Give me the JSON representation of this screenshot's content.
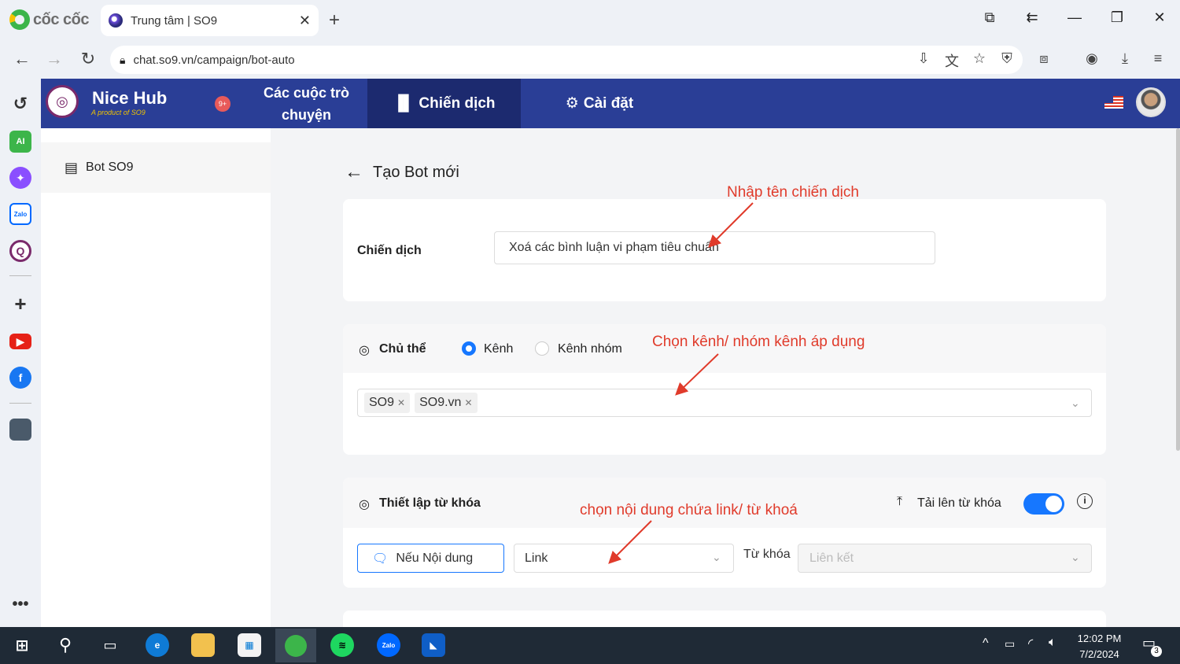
{
  "browser": {
    "brand": "cốc cốc",
    "tab_title": "Trung tâm | SO9",
    "url": "chat.so9.vn/campaign/bot-auto"
  },
  "app": {
    "name": "Nice Hub",
    "tagline": "A product of SO9",
    "notif_count": "9+",
    "nav": {
      "conversations": "Các cuộc trò chuyện",
      "campaign": "Chiến dịch",
      "settings": "Cài đặt"
    }
  },
  "sidebar": {
    "items": [
      {
        "label": "Bot SO9"
      }
    ]
  },
  "page": {
    "title": "Tạo Bot mới",
    "campaign": {
      "label": "Chiến dịch",
      "value": "Xoá các bình luận vi phạm tiêu chuẩn"
    },
    "subject": {
      "label": "Chủ thể",
      "options": [
        "Kênh",
        "Kênh nhóm"
      ],
      "selected": "Kênh",
      "tags": [
        "SO9",
        "SO9.vn"
      ]
    },
    "keyword": {
      "label": "Thiết lập từ khóa",
      "upload_label": "Tải lên từ khóa",
      "toggle_on": true,
      "condition_button": "Nếu Nội dung",
      "condition_value": "Link",
      "keyword_label": "Từ khóa",
      "keyword_placeholder": "Liên kết"
    }
  },
  "annotations": {
    "campaign_name": "Nhập tên chiến dịch",
    "channel": "Chọn kênh/ nhóm kênh áp dụng",
    "content": "chọn nội dung chứa link/ từ khoá"
  },
  "taskbar": {
    "time": "12:02 PM",
    "date": "7/2/2024",
    "notification_count": "3"
  },
  "colors": {
    "header": "#2a3e96",
    "active_nav": "#1c2a6f",
    "accent": "#1677ff",
    "annotation": "#e03b2b"
  }
}
